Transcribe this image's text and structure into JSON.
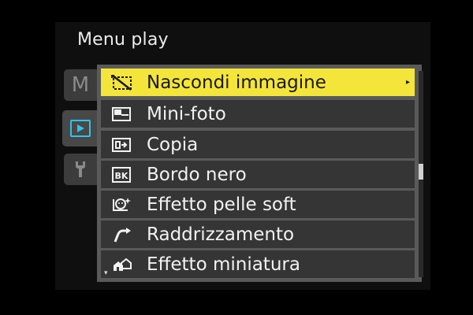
{
  "title": "Menu play",
  "tabs": [
    {
      "label": "M",
      "icon": "camera-menu-icon",
      "active": false
    },
    {
      "icon": "play-icon",
      "active": true,
      "color": "#2fc4e8"
    },
    {
      "icon": "wrench-icon",
      "active": false
    }
  ],
  "menu_items": [
    {
      "label": "Nascondi immagine",
      "icon": "hide-image-icon",
      "selected": true,
      "has_submenu": true,
      "submenu_glyph": "▸"
    },
    {
      "label": "Mini-foto",
      "icon": "mini-photo-icon"
    },
    {
      "label": "Copia",
      "icon": "copy-icon"
    },
    {
      "label": "Bordo nero",
      "icon": "black-border-icon",
      "icon_text": "BK"
    },
    {
      "label": "Effetto pelle soft",
      "icon": "soft-skin-icon"
    },
    {
      "label": "Raddrizzamento",
      "icon": "straighten-icon"
    },
    {
      "label": "Effetto miniatura",
      "icon": "miniature-effect-icon"
    }
  ],
  "colors": {
    "highlight": "#f4e53a",
    "accent": "#2fc4e8",
    "row_bg": "#353535"
  },
  "more_below_glyph": "▾"
}
